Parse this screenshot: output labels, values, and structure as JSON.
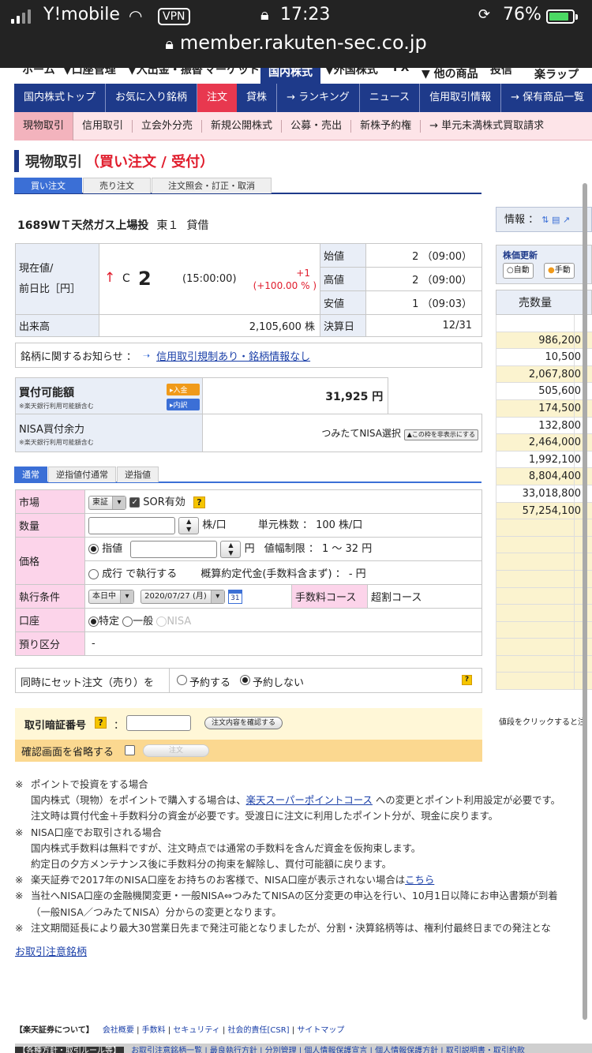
{
  "status": {
    "carrier": "Y!mobile",
    "vpn": "VPN",
    "time": "17:23",
    "battery": "76%",
    "url": "member.rakuten-sec.co.jp"
  },
  "topnav": [
    "ホーム",
    "▼口座管理",
    "▼入出金・振替",
    "マーケット",
    "国内株式",
    "▼外国株式",
    "FX",
    "▼ 他の商品",
    "投信",
    "楽ラップ"
  ],
  "subnav": [
    "国内株式トップ",
    "お気に入り銘柄",
    "注文",
    "貸株",
    "→ ランキング",
    "ニュース",
    "信用取引情報",
    "→ 保有商品一覧"
  ],
  "subnav2": [
    "現物取引",
    "信用取引",
    "立会外分売",
    "新規公開株式",
    "公募・売出",
    "新株予約権",
    "→ 単元未満株式買取請求"
  ],
  "title": {
    "main": "現物取引",
    "sub": "（買い注文 / 受付）"
  },
  "tabs": [
    "買い注文",
    "売り注文",
    "注文照会・訂正・取消"
  ],
  "stock": {
    "name": "1689WＴ天然ガス上場投",
    "market": "東１",
    "lending": "貸借"
  },
  "price": {
    "label1": "現在値/",
    "label2": "前日比［円］",
    "arrow": "↑",
    "flag": "C",
    "value": "2",
    "time": "(15:00:00)",
    "change": "+1",
    "change_pct": "(+100.00 % )",
    "open_label": "始値",
    "open": "2 （09:00）",
    "high_label": "高値",
    "high": "2 （09:00）",
    "low_label": "安値",
    "low": "1 （09:03）",
    "volume_label": "出来高",
    "volume": "2,105,600 株",
    "settle_label": "決算日",
    "settle": "12/31"
  },
  "notice": {
    "label": "銘柄に関するお知らせ ：",
    "link": "信用取引規制あり・銘柄情報なし"
  },
  "buy_power": {
    "label": "買付可能額",
    "note": "※楽天銀行利用可能額含む",
    "btn_in": "▸入金",
    "btn_detail": "▸内訳",
    "value": "31,925 円",
    "nisa_label": "NISA買付余力",
    "nisa_note": "※楽天銀行利用可能額含む",
    "nisa_value": "つみたてNISA選択",
    "nisa_btn": "▲この枠を非表示にする"
  },
  "order_tabs": [
    "通常",
    "逆指値付通常",
    "逆指値"
  ],
  "form": {
    "market_label": "市場",
    "market": "東証",
    "sor": "SOR有効",
    "qty_label": "数量",
    "qty_unit": "株/口",
    "unit_label": "単元株数 ： 100 株/口",
    "price_label": "価格",
    "limit": "指値",
    "yen": "円",
    "range": "値幅制限 ： 1 〜 32 円",
    "market_order": "成行 で執行する",
    "estimate": "概算約定代金(手数料含まず) ： - 円",
    "cond_label": "執行条件",
    "cond": "本日中",
    "date": "2020/07/27 (月)",
    "cal_day": "31",
    "fee_label": "手数料コース",
    "fee": "超割コース",
    "acct_label": "口座",
    "acct1": "特定",
    "acct2": "一般",
    "acct3": "NISA",
    "deposit_label": "預り区分",
    "deposit": "-"
  },
  "set_order": {
    "label": "同時にセット注文（売り）を",
    "opt1": "予約する",
    "opt2": "予約しない"
  },
  "password": {
    "label": "取引暗証番号",
    "colon": "：",
    "confirm": "注文内容を確認する"
  },
  "skip": {
    "label": "確認画面を省略する",
    "btn": "注文"
  },
  "notes": [
    {
      "bullet": "※",
      "text": "ポイントで投資をする場合"
    },
    {
      "bullet": "",
      "text": "国内株式（現物）をポイントで購入する場合は、",
      "link": "楽天スーパーポイントコース",
      "after": " への変更とポイント利用設定が必要です。"
    },
    {
      "bullet": "",
      "text": "注文時は買付代金＋手数料分の資金が必要です。受渡日に注文に利用したポイント分が、現金に戻ります。"
    },
    {
      "bullet": "※",
      "text": "NISA口座でお取引される場合"
    },
    {
      "bullet": "",
      "text": "国内株式手数料は無料ですが、注文時点では通常の手数料を含んだ資金を仮拘束します。"
    },
    {
      "bullet": "",
      "text": "約定日の夕方メンテナンス後に手数料分の拘束を解除し、買付可能額に戻ります。"
    },
    {
      "bullet": "※",
      "text": "楽天証券で2017年のNISA口座をお持ちのお客様で、NISA口座が表示されない場合は",
      "link": "こちら",
      "after": ""
    },
    {
      "bullet": "※",
      "text": "当社へNISA口座の金融機関変更・一般NISA⇔つみたてNISAの区分変更の申込を行い、10月1日以降にお申込書類が到着"
    },
    {
      "bullet": "",
      "text": "（一般NISA／つみたてNISA）分からの変更となります。"
    },
    {
      "bullet": "※",
      "text": "注文期間延長により最大30営業日先まで発注可能となりましたが、分割・決算銘柄等は、権利付最終日までの発注とな"
    }
  ],
  "caution_link": "お取引注意銘柄",
  "footer1": {
    "head": "【楽天証券について】",
    "links": [
      "会社概要",
      "手数料",
      "セキュリティ",
      "社会的責任[CSR]",
      "サイトマップ"
    ]
  },
  "footer2": {
    "head": "【各種方針・取引ルール等】",
    "text": "お取引注意銘柄一覧 | 最良執行方針 | 分別管理 | 個人情報保護宣言 | 個人情報保護方針 | 取引説明書・取引約款"
  },
  "right": {
    "info": "情報 ：",
    "update": "株価更新",
    "auto": "自動",
    "manual": "手動",
    "header": "売数量",
    "rows": [
      "",
      "986,200",
      "10,500",
      "2,067,800",
      "505,600",
      "174,500",
      "132,800",
      "2,464,000",
      "1,992,100",
      "8,804,400",
      "33,018,800",
      "57,254,100",
      "",
      "",
      "",
      "",
      "",
      "",
      "",
      "",
      "",
      "",
      ""
    ],
    "click": "値段をクリックすると注"
  }
}
